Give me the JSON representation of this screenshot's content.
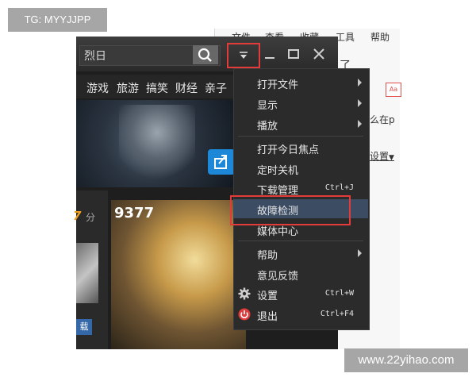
{
  "corner": {
    "tag": "TG: MYYJJPP",
    "watermark": "www.22yihao.com"
  },
  "background_window": {
    "menubar": [
      "文件",
      "查看",
      "收藏",
      "工具",
      "帮助"
    ],
    "snippet_1": "了",
    "snippet_2": "么在p",
    "settings_label": "设置",
    "badge_text": "Aa"
  },
  "player": {
    "search": {
      "value": "烈日"
    },
    "categories": [
      "游戏",
      "旅游",
      "搞笑",
      "财经",
      "亲子"
    ],
    "score": {
      "value": "7",
      "unit": "分"
    },
    "thumb_button": "载",
    "game_logo": "9377",
    "colors": {
      "titlebar": "#333333",
      "accent_share": "#1e88d8",
      "highlight_frame": "#e33a3a"
    }
  },
  "menu": {
    "items": [
      {
        "label": "打开文件",
        "submenu": true
      },
      {
        "label": "显示",
        "submenu": true
      },
      {
        "label": "播放",
        "submenu": true
      },
      {
        "label": "打开今日焦点"
      },
      {
        "label": "定时关机"
      },
      {
        "label": "下载管理",
        "shortcut": "Ctrl+J"
      },
      {
        "label": "故障检测",
        "highlighted": true
      },
      {
        "label": "媒体中心"
      },
      {
        "label": "帮助",
        "submenu": true
      },
      {
        "label": "意见反馈"
      },
      {
        "label": "设置",
        "shortcut": "Ctrl+W",
        "icon": "gear-icon"
      },
      {
        "label": "退出",
        "shortcut": "Ctrl+F4",
        "icon": "power-icon"
      }
    ]
  }
}
